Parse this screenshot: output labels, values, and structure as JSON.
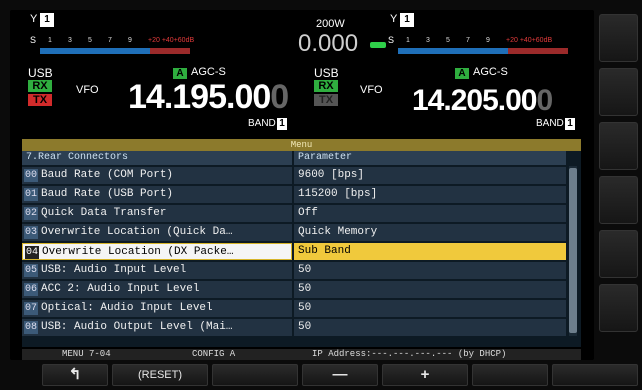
{
  "left_vfo": {
    "antenna": "Y",
    "antenna_num": "1",
    "s_label": "S",
    "scale": [
      "1",
      "3",
      "5",
      "7",
      "9"
    ],
    "scale_red": "+20  +40+60dB",
    "mode": "USB",
    "rx": "RX",
    "tx": "TX",
    "agc_box": "A",
    "agc": "AGC-S",
    "vfo": "VFO",
    "freq_main": "14.195.00",
    "freq_dim": "0",
    "band": "BAND",
    "band_num": "1"
  },
  "center": {
    "power": "200W",
    "meter": "0.000",
    "menu_title": "Menu"
  },
  "right_vfo": {
    "antenna": "Y",
    "antenna_num": "1",
    "s_label": "S",
    "scale": [
      "1",
      "3",
      "5",
      "7",
      "9"
    ],
    "scale_red": "+20  +40+60dB",
    "mode": "USB",
    "rx": "RX",
    "tx": "TX",
    "agc_box": "A",
    "agc": "AGC-S",
    "vfo": "VFO",
    "freq_main": "14.205.00",
    "freq_dim": "0",
    "band": "BAND",
    "band_num": "1"
  },
  "menu": {
    "header_left": "7.Rear Connectors",
    "header_right": "Parameter",
    "rows": [
      {
        "idx": "00",
        "name": "Baud Rate (COM Port)",
        "value": "9600 [bps]"
      },
      {
        "idx": "01",
        "name": "Baud Rate (USB Port)",
        "value": "115200 [bps]"
      },
      {
        "idx": "02",
        "name": "Quick Data Transfer",
        "value": "Off"
      },
      {
        "idx": "03",
        "name": "Overwrite Location (Quick Da…",
        "value": "Quick Memory"
      },
      {
        "idx": "04",
        "name": "Overwrite Location (DX Packe…",
        "value": "Sub Band"
      },
      {
        "idx": "05",
        "name": "USB: Audio Input Level",
        "value": "50"
      },
      {
        "idx": "06",
        "name": "ACC 2: Audio Input Level",
        "value": "50"
      },
      {
        "idx": "07",
        "name": "Optical: Audio Input Level",
        "value": "50"
      },
      {
        "idx": "08",
        "name": "USB: Audio Output Level (Mai…",
        "value": "50"
      }
    ]
  },
  "status": {
    "menu": "MENU 7-04",
    "config": "CONFIG A",
    "ip": "IP Address:---.---.---.--- (by DHCP)"
  },
  "softkeys": {
    "back": "↰",
    "reset": "(RESET)",
    "minus": "—",
    "plus": "+"
  },
  "colors": {
    "selected_value_bg": "#f0c93c",
    "rx_green": "#2fae3f",
    "tx_red": "#d22b2b"
  }
}
